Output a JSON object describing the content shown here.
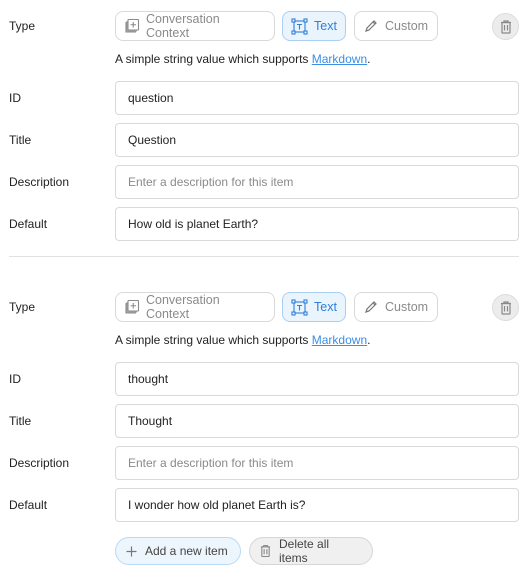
{
  "items": [
    {
      "type_label": "Type",
      "type_options": [
        {
          "label": "Conversation Context",
          "icon": "conversation-context-icon",
          "selected": false
        },
        {
          "label": "Text",
          "icon": "text-box-icon",
          "selected": true
        },
        {
          "label": "Custom",
          "icon": "pencil-icon",
          "selected": false
        }
      ],
      "hint_text": "A simple string value which supports ",
      "hint_link": "Markdown",
      "hint_suffix": ".",
      "fields": [
        {
          "label": "ID",
          "value": "question",
          "placeholder": ""
        },
        {
          "label": "Title",
          "value": "Question",
          "placeholder": ""
        },
        {
          "label": "Description",
          "value": "",
          "placeholder": "Enter a description for this item"
        },
        {
          "label": "Default",
          "value": "How old is planet Earth?",
          "placeholder": ""
        }
      ]
    },
    {
      "type_label": "Type",
      "type_options": [
        {
          "label": "Conversation Context",
          "icon": "conversation-context-icon",
          "selected": false
        },
        {
          "label": "Text",
          "icon": "text-box-icon",
          "selected": true
        },
        {
          "label": "Custom",
          "icon": "pencil-icon",
          "selected": false
        }
      ],
      "hint_text": "A simple string value which supports ",
      "hint_link": "Markdown",
      "hint_suffix": ".",
      "fields": [
        {
          "label": "ID",
          "value": "thought",
          "placeholder": ""
        },
        {
          "label": "Title",
          "value": "Thought",
          "placeholder": ""
        },
        {
          "label": "Description",
          "value": "",
          "placeholder": "Enter a description for this item"
        },
        {
          "label": "Default",
          "value": "I wonder how old planet Earth is?",
          "placeholder": ""
        }
      ]
    }
  ],
  "actions": {
    "add_label": "Add a new item",
    "delete_all_label": "Delete all items"
  },
  "colors": {
    "accent": "#2f7fd8",
    "link": "#3a8ee6",
    "active_bg": "#eaf4fd"
  }
}
